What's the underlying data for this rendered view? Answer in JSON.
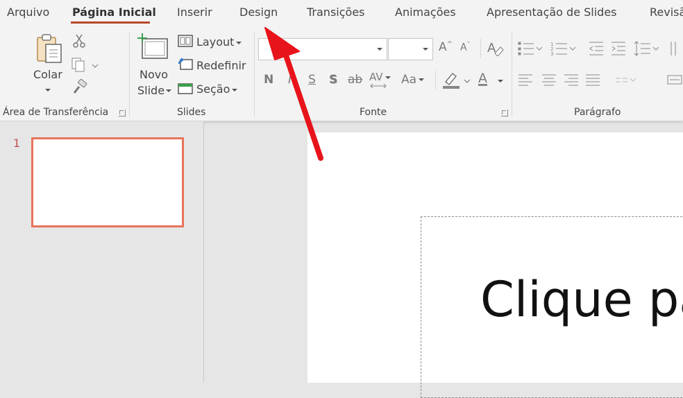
{
  "tabs": [
    {
      "label": "Arquivo"
    },
    {
      "label": "Página Inicial"
    },
    {
      "label": "Inserir"
    },
    {
      "label": "Design"
    },
    {
      "label": "Transições"
    },
    {
      "label": "Animações"
    },
    {
      "label": "Apresentação de Slides"
    },
    {
      "label": "Revisã"
    }
  ],
  "active_tab": "Página Inicial",
  "ribbon": {
    "clipboard": {
      "paste_label": "Colar",
      "group_label": "Área de Transferência"
    },
    "slides": {
      "new_slide_line1": "Novo",
      "new_slide_line2": "Slide",
      "layout_label": "Layout",
      "reset_label": "Redefinir",
      "section_label": "Seção",
      "group_label": "Slides"
    },
    "font": {
      "group_label": "Fonte",
      "bold": "N",
      "italic": "I",
      "underline": "S",
      "shadow": "S",
      "strike": "ab",
      "spacing": "AV",
      "case": "Aa",
      "grow": "A",
      "shrink": "A",
      "font_color": "A"
    },
    "paragraph": {
      "group_label": "Parágrafo"
    }
  },
  "thumbnails": [
    {
      "number": "1"
    }
  ],
  "slide": {
    "title_placeholder": "Clique pa"
  },
  "colors": {
    "accent": "#b7472a",
    "thumb_border": "#e8735a",
    "arrow": "#e8141b"
  }
}
